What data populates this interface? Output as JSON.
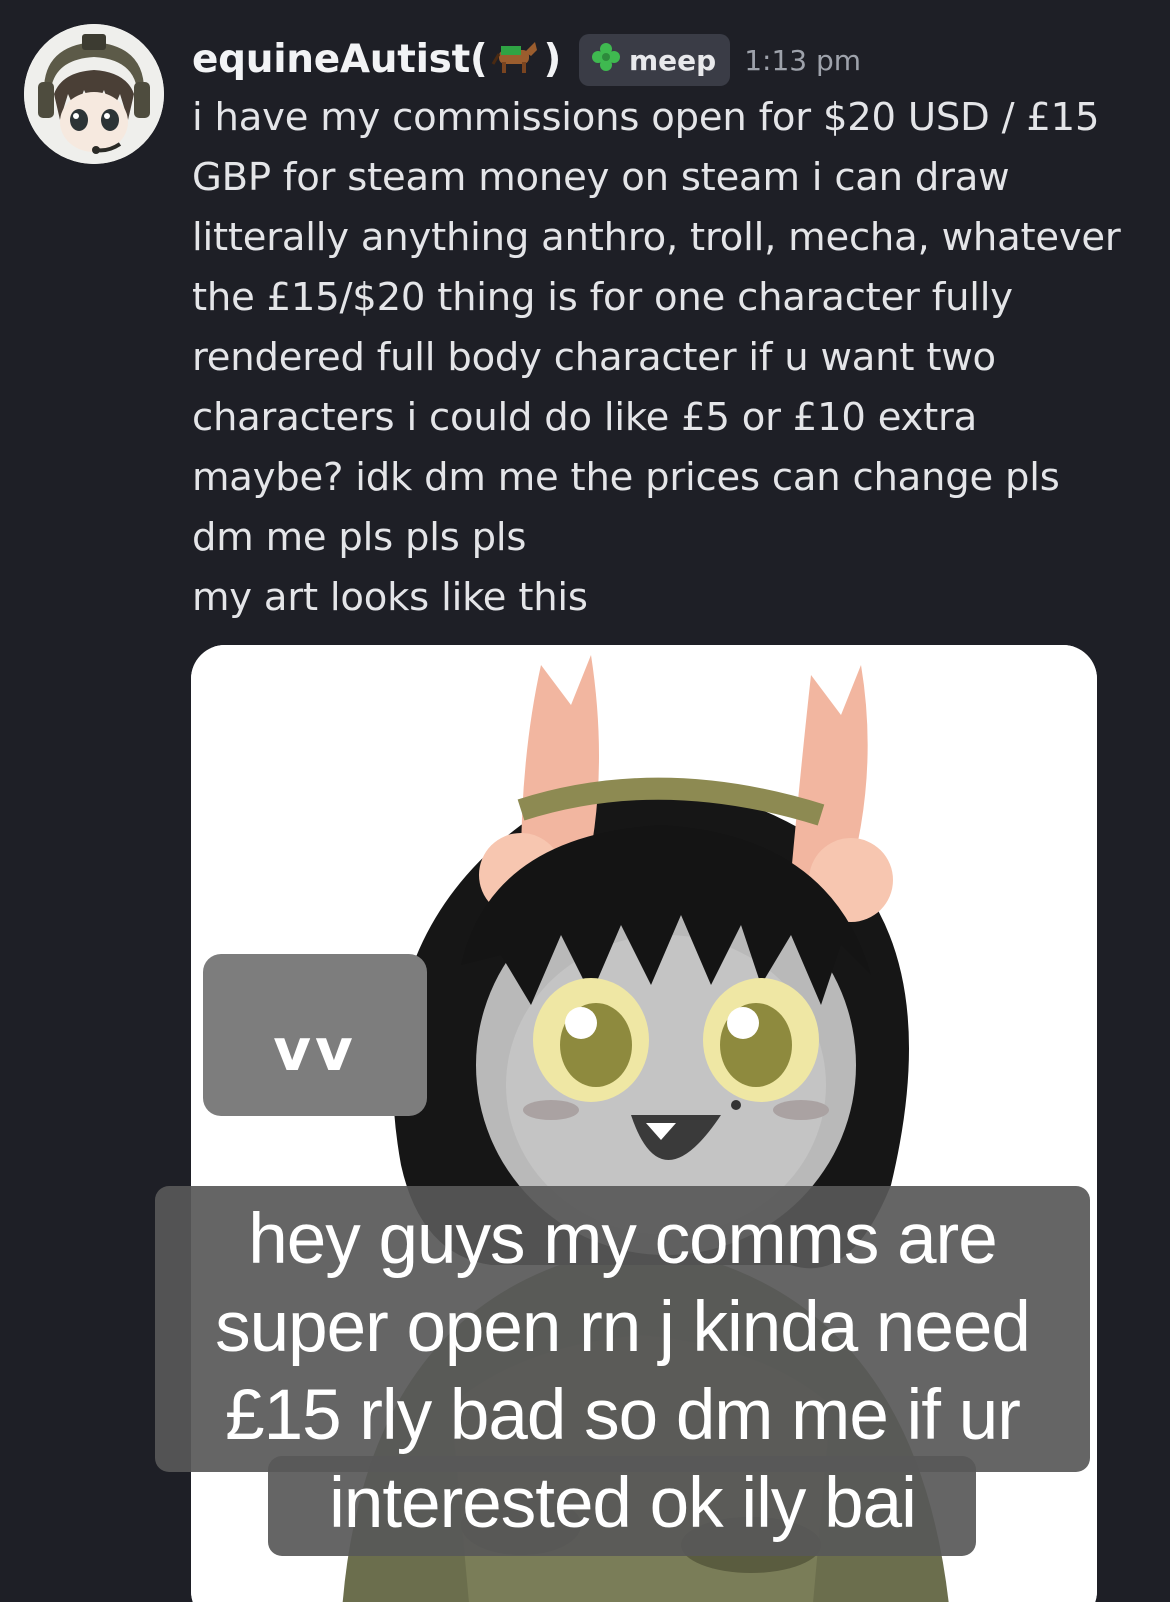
{
  "post": {
    "username": "equineAutist(",
    "username_close": ")",
    "username_emoji": "horse-emoji",
    "role": "meep",
    "role_icon": "clover-icon",
    "timestamp": "1:13 pm"
  },
  "message": {
    "paragraph1": "i have my commissions open for $20 USD / £15 GBP for steam money on steam i can draw litterally anything anthro, troll, mecha, whatever the £15/$20 thing is for one character fully rendered full body character if u want two characters i could do like £5 or £10 extra maybe? idk dm me the prices can change pls dm me pls pls pls",
    "paragraph2": "my art looks like this"
  },
  "attachment": {
    "sticker_text": "vv",
    "caption_lines": [
      "hey guys my comms are",
      "super open rn j kinda need",
      "£15 rly bad so dm me if ur",
      "interested ok ily bai"
    ]
  },
  "colors": {
    "background": "#1e1f26",
    "text": "#e4e5e8",
    "role_tag": "#3a3c46",
    "timestamp": "#9ea2ab"
  }
}
